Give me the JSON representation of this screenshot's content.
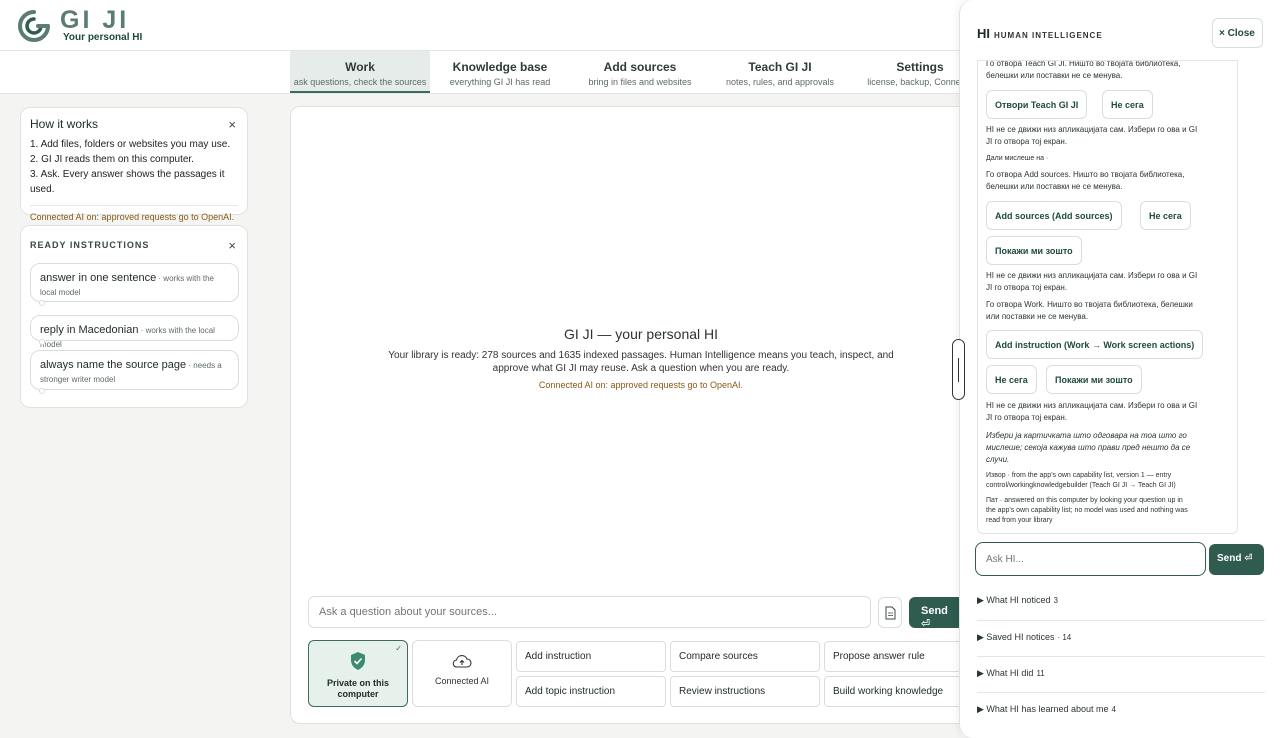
{
  "app": {
    "logo_text": "GI JI",
    "tagline": "Your personal HI"
  },
  "nav": {
    "tabs": [
      {
        "label": "Work",
        "sub": "ask questions, check the sources"
      },
      {
        "label": "Knowledge base",
        "sub": "everything GI JI has read"
      },
      {
        "label": "Add sources",
        "sub": "bring in files and websites"
      },
      {
        "label": "Teach GI JI",
        "sub": "notes, rules, and approvals"
      },
      {
        "label": "Settings",
        "sub": "license, backup, Connecte"
      }
    ]
  },
  "how_it_works": {
    "title": "How it works",
    "close": "×",
    "steps": [
      "1. Add files, folders or websites you may use.",
      "2. GI JI reads them on this computer.",
      "3. Ask. Every answer shows the passages it used."
    ],
    "notice": "Connected AI on: approved requests go to OpenAI."
  },
  "ready": {
    "title": "READY INSTRUCTIONS",
    "close": "×",
    "items": [
      {
        "text": "answer in one sentence",
        "meta": " · works with the local model"
      },
      {
        "text": "reply in Macedonian",
        "meta": " · works with the local model"
      },
      {
        "text": "always name the source page",
        "meta": " · needs a stronger writer model"
      }
    ]
  },
  "main": {
    "title": "GI JI — your personal HI",
    "description": "Your library is ready: 278 sources and 1635 indexed passages. Human Intelligence means you teach, inspect, and approve what GI JI may reuse. Ask a question when you are ready.",
    "notice": "Connected AI on: approved requests go to OpenAI.",
    "ask_placeholder": "Ask a question about your sources...",
    "send_label": "Send ⏎",
    "modes": {
      "private": "Private on this computer",
      "ai": "Connected AI"
    },
    "actions": [
      "Add instruction",
      "Compare sources",
      "Propose answer rule",
      "Add topic instruction",
      "Review instructions",
      "Build working knowledge"
    ]
  },
  "panel": {
    "title": "HI",
    "subtitle": "HUMAN INTELLIGENCE",
    "close_label": "× Close",
    "convo": {
      "l0": "Го отвора Teach GI JI. Ништо во твојата библиотека,",
      "l1": "белешки или поставки не се менува.",
      "b_teach": "Отвори Teach GI JI",
      "b_not1": "Не сега",
      "l2": "HI не се движи низ апликацијата сам. Избери го ова и GI",
      "l3": "JI го отвора тој екран.",
      "l4": "Дали мислеше на ·",
      "l5": "Го отвора Add sources. Ништо во твојата библиотека,",
      "l6": "белешки или поставки не се менува.",
      "b_add": "Add sources (Add sources)",
      "b_not2": "Не сега",
      "b_why1": "Покажи ми зошто",
      "l7": "HI не се движи низ апликацијата сам. Избери го ова и GI",
      "l8": "JI го отвора тој екран.",
      "l9": "Го отвора Work. Ништо во твојата библиотека, белешки",
      "l10": "или поставки не се менува.",
      "b_instr": "Add instruction (Work → Work screen actions)",
      "b_not3": "Не сега",
      "b_why2": "Покажи ми зошто",
      "l11": "HI не се движи низ апликацијата сам. Избери го ова и GI",
      "l12": "JI го отвора тој екран.",
      "l13": "Избери ја картичката што одговара на тоа што го",
      "l14": "мислеше; секоја кажува што прави пред нешто да се",
      "l15": "случи.",
      "l16": "Извор · from the app's own capability list, version 1 — entry",
      "l17": "control/workingknowledgebuilder (Teach GI JI → Teach GI JI)",
      "l18": "Пат · answered on this computer by looking your question up in",
      "l19": "the app's own capability list; no model was used and nothing was",
      "l20": "read from your library"
    },
    "ask_placeholder": "Ask HI...",
    "send_label": "Send ⏎",
    "disclosures": [
      {
        "label": "▶  What HI noticed",
        "count": "3"
      },
      {
        "label": "▶  Saved HI notices",
        "count": "· 14"
      },
      {
        "label": "▶  What HI did",
        "count": "11"
      },
      {
        "label": "▶  What HI has learned about me",
        "count": "4"
      }
    ]
  }
}
